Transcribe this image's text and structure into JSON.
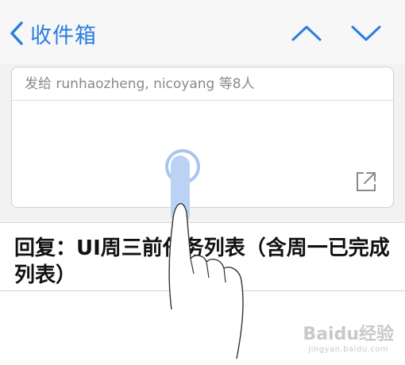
{
  "nav": {
    "back_label": "收件箱",
    "accent_color": "#2a7de1"
  },
  "compose": {
    "recipients": "发给 runhaozheng, nicoyang 等8人"
  },
  "message": {
    "subject": "回复：UI周三前任务列表（含周一已完成列表）"
  },
  "icons": {
    "back": "chevron-left-icon",
    "prev": "chevron-up-icon",
    "next": "chevron-down-icon",
    "expand": "expand-arrow-icon"
  },
  "watermark": {
    "brand": "Baidu经验",
    "url": "jingyan.baidu.com"
  }
}
